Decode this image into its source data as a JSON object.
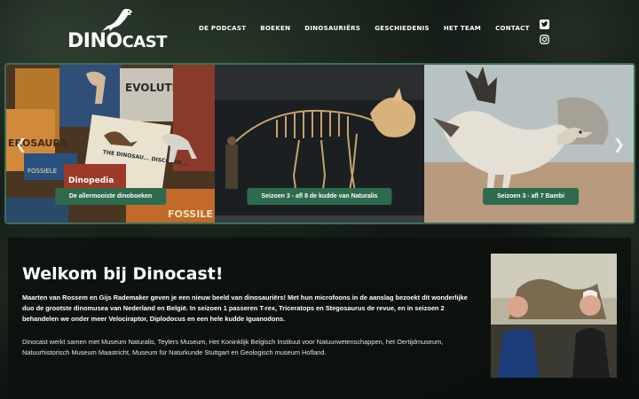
{
  "brand": {
    "logo_primary": "DINO",
    "logo_secondary": "CAST",
    "accent": "#2e6b4d"
  },
  "nav": {
    "items": [
      {
        "label": "DE PODCAST"
      },
      {
        "label": "BOEKEN"
      },
      {
        "label": "DINOSAURIËRS"
      },
      {
        "label": "GESCHIEDENIS"
      },
      {
        "label": "HET TEAM"
      },
      {
        "label": "CONTACT"
      }
    ]
  },
  "social": {
    "icons": [
      "twitter-icon",
      "instagram-icon"
    ]
  },
  "carousel": {
    "slides": [
      {
        "caption": "De allermooiste dinoboeken",
        "book_texts": [
          "EVOLUTIE",
          "EROSAURS",
          "Dinopedia",
          "THE DINOSAU... DISCOVER...",
          "FOSSIELE",
          "FOSSILE"
        ]
      },
      {
        "caption": "Seizoen 3 - afl 8 de kudde van Naturalis"
      },
      {
        "caption": "Seizoen 3 - afl 7 Bambi"
      }
    ]
  },
  "main": {
    "title": "Welkom bij Dinocast!",
    "intro": "Maarten van Rossem en Gijs Rademaker geven je een nieuw beeld van dinosauriërs! Met hun microfoons in de aanslag bezoekt dit wonderlijke duo de grootste dinomusea van Nederland en België. In seizoen 1 passeren T-rex, Triceratops en Stegosaurus de revue, en in seizoen 2 behandelen we onder meer Velociraptor, Diplodocus en een hele kudde Iguanodons.",
    "partners": "Dinocast werkt samen met Museum Naturalis, Teylers Museum, Het Koninklijk Belgisch Instituut voor Natuurwetenschappen, het Oertijdmuseum, Natuurhistorisch Museum Maastricht, Museum für Naturkunde Stuttgart en Geologisch museum Hofland."
  }
}
